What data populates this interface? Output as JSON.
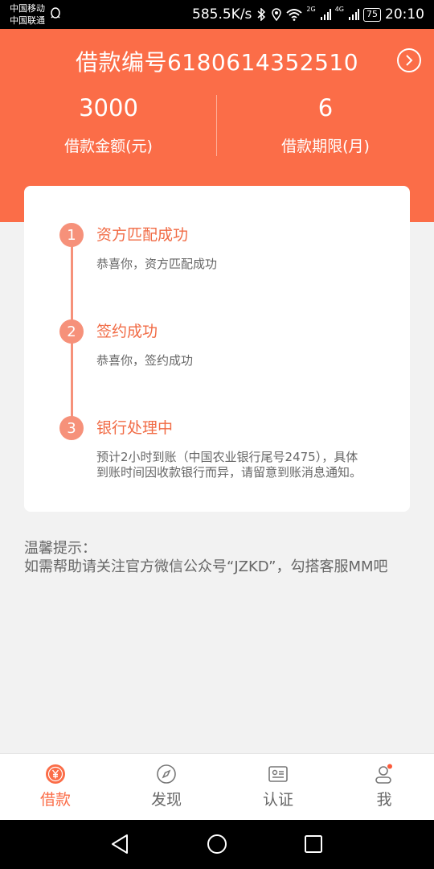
{
  "status_bar": {
    "carrier1": "中国移动",
    "carrier2": "中国联通",
    "speed": "585.5K/s",
    "net1": "2G",
    "net2": "4G",
    "battery": "75",
    "time": "20:10"
  },
  "header": {
    "loan_number": "借款编号6180614352510",
    "amount_value": "3000",
    "amount_label": "借款金额(元)",
    "term_value": "6",
    "term_label": "借款期限(月)",
    "bg_color": "#fb6d48"
  },
  "steps": [
    {
      "num": "1",
      "title": "资方匹配成功",
      "desc": "恭喜你，资方匹配成功"
    },
    {
      "num": "2",
      "title": "签约成功",
      "desc": "恭喜你，签约成功"
    },
    {
      "num": "3",
      "title": "银行处理中",
      "desc": "预计2小时到账（中国农业银行尾号2475），具体到账时间因收款银行而异，请留意到账消息通知。"
    }
  ],
  "tips": {
    "title": "温馨提示：",
    "body": "如需帮助请关注官方微信公众号“JZKD”，勾搭客服MM吧"
  },
  "tabbar": {
    "items": [
      {
        "label": "借款",
        "icon": "yen-circle-icon",
        "active": true
      },
      {
        "label": "发现",
        "icon": "compass-icon",
        "active": false
      },
      {
        "label": "认证",
        "icon": "id-card-icon",
        "active": false
      },
      {
        "label": "我",
        "icon": "person-icon",
        "active": false
      }
    ]
  }
}
